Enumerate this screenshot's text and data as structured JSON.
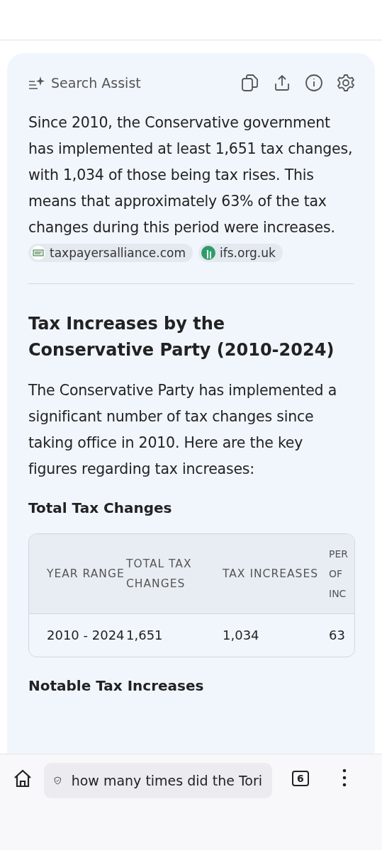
{
  "assist": {
    "title": "Search Assist"
  },
  "summary": "Since 2010, the Conservative government has implemented at least 1,651 tax changes, with 1,034 of those being tax rises. This means that approximately 63% of the tax changes during this period were increases.",
  "sources": [
    {
      "label": "taxpayersalliance.com",
      "kind": "tpa"
    },
    {
      "label": "ifs.org.uk",
      "kind": "ifs"
    }
  ],
  "heading": "Tax Increases by the Conservative Party (2010-2024)",
  "intro": "The Conservative Party has implemented a significant number of tax changes since taking office in 2010. Here are the key figures regarding tax increases:",
  "subheading": "Total Tax Changes",
  "table": {
    "columns": [
      "YEAR RANGE",
      "TOTAL TAX CHANGES",
      "TAX INCREASES",
      "PER OF INC"
    ],
    "rows": [
      [
        "2010 - 2024",
        "1,651",
        "1,034",
        "63"
      ]
    ]
  },
  "next_heading": "Notable Tax Increases",
  "bottom_bar": {
    "address": "how many times did the Tori",
    "tab_count": "6"
  }
}
